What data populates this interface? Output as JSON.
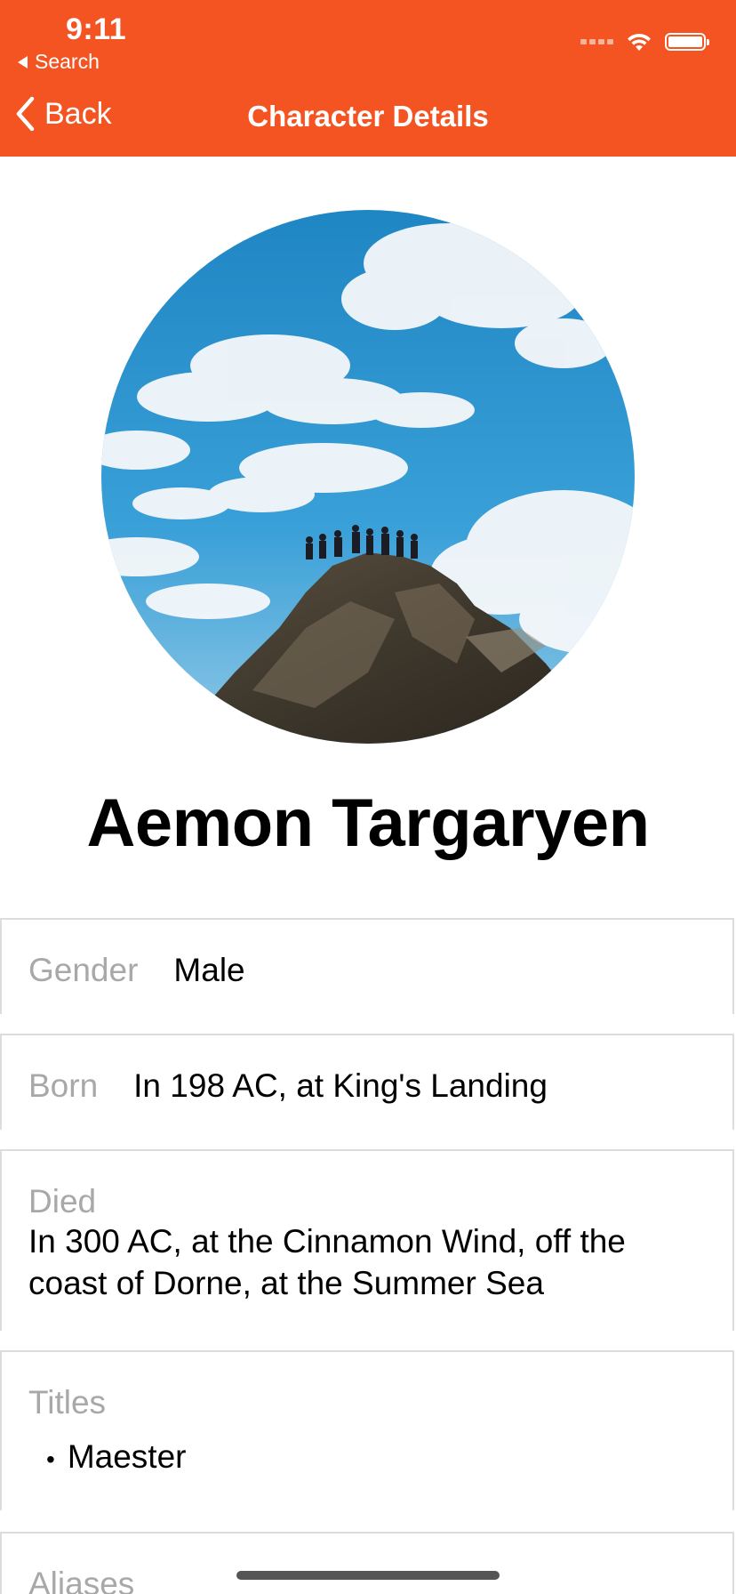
{
  "status_bar": {
    "time": "9:11",
    "back_app": "Search"
  },
  "nav": {
    "back_label": "Back",
    "title": "Character Details"
  },
  "colors": {
    "header": "#F45422",
    "label": "#a8a8a8",
    "divider": "#dcdcdc"
  },
  "character": {
    "name": "Aemon Targaryen"
  },
  "details": {
    "gender": {
      "label": "Gender",
      "value": "Male"
    },
    "born": {
      "label": "Born",
      "value": "In 198 AC, at King's Landing"
    },
    "died": {
      "label": "Died",
      "value": "In 300 AC, at the Cinnamon Wind, off the coast of Dorne, at the Summer Sea"
    },
    "titles": {
      "label": "Titles",
      "items": [
        "Maester"
      ]
    },
    "aliases": {
      "label": "Aliases"
    }
  }
}
